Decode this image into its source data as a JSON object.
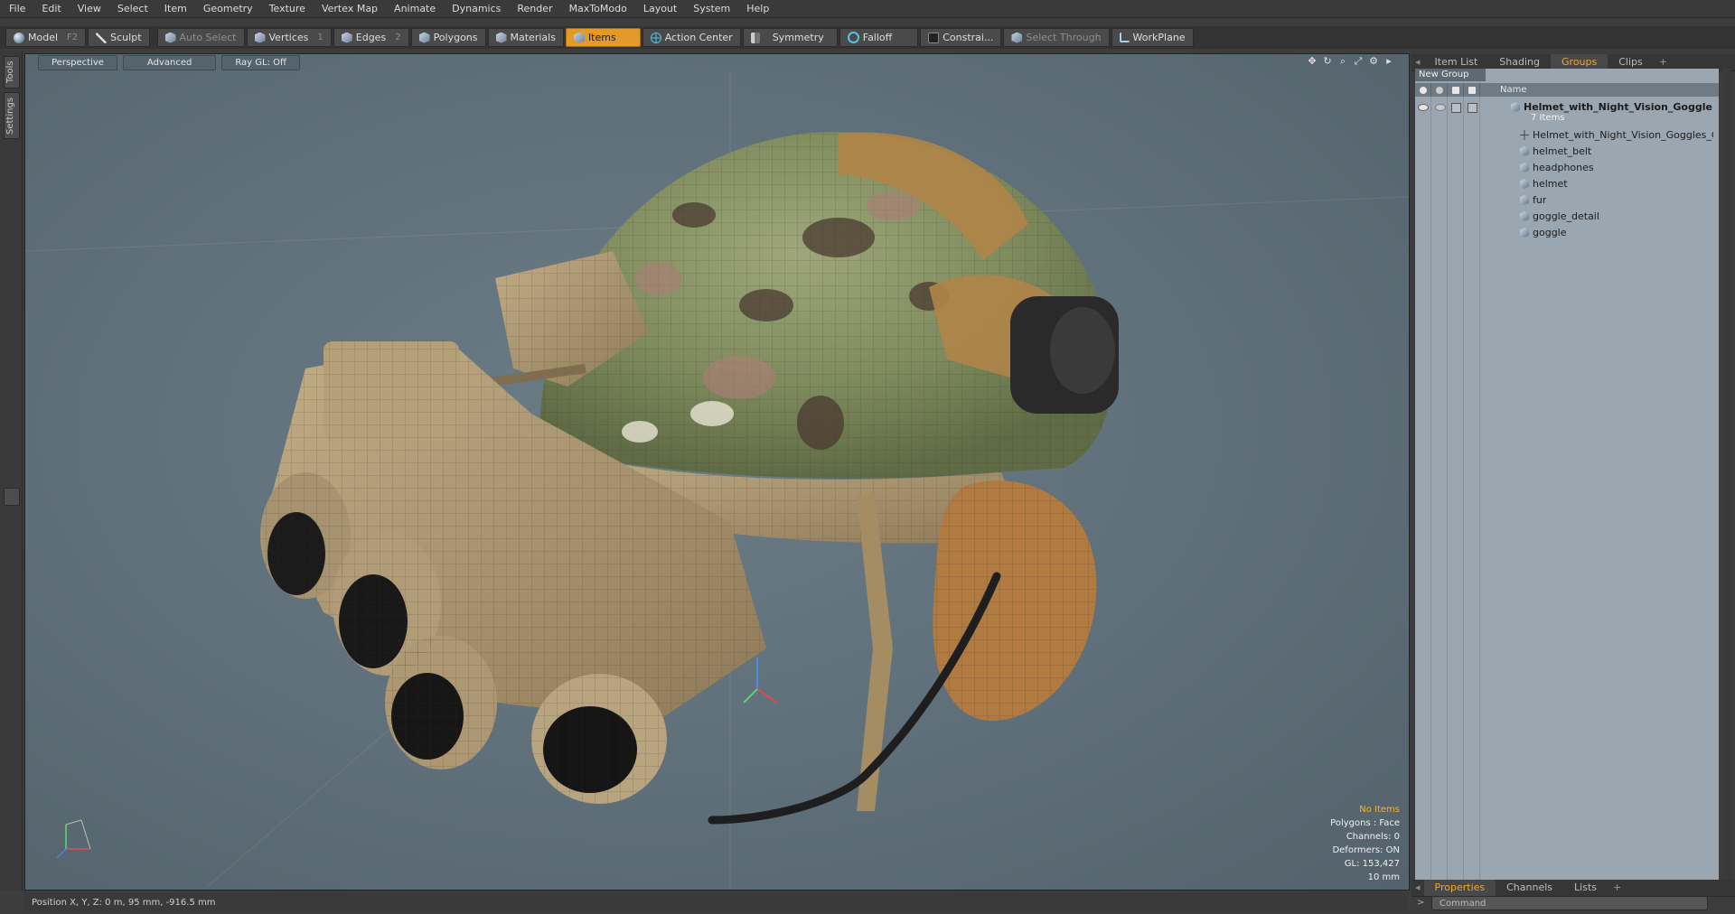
{
  "menu": [
    "File",
    "Edit",
    "View",
    "Select",
    "Item",
    "Geometry",
    "Texture",
    "Vertex Map",
    "Animate",
    "Dynamics",
    "Render",
    "MaxToModo",
    "Layout",
    "System",
    "Help"
  ],
  "toolbar": {
    "model": {
      "label": "Model",
      "key": "F2",
      "icon": "sphere-icon"
    },
    "sculpt": {
      "label": "Sculpt",
      "icon": "brush-icon"
    },
    "auto_select": {
      "label": "Auto Select",
      "icon": "cube-icon"
    },
    "vertices": {
      "label": "Vertices",
      "key": "1",
      "icon": "cube-icon"
    },
    "edges": {
      "label": "Edges",
      "key": "2",
      "icon": "cube-icon"
    },
    "polygons": {
      "label": "Polygons",
      "icon": "cube-icon"
    },
    "materials": {
      "label": "Materials",
      "icon": "cube-icon"
    },
    "items": {
      "label": "Items",
      "icon": "cube-icon",
      "active": true
    },
    "action_center": {
      "label": "Action Center",
      "icon": "crosshair-icon"
    },
    "symmetry": {
      "label": "Symmetry",
      "icon": "symmetry-icon"
    },
    "falloff": {
      "label": "Falloff",
      "icon": "ring-icon"
    },
    "constraints": {
      "label": "Constrai...",
      "icon": "box-icon"
    },
    "select_through": {
      "label": "Select Through",
      "icon": "cube-icon"
    },
    "workplane": {
      "label": "WorkPlane",
      "icon": "workplane-icon"
    }
  },
  "left_tabs": [
    "Tools",
    "Settings"
  ],
  "viewport": {
    "buttons": [
      "Perspective",
      "Advanced",
      "Ray GL: Off"
    ],
    "info": {
      "selection": "No Items",
      "polygons": "Polygons : Face",
      "channels": "Channels: 0",
      "deformers": "Deformers: ON",
      "gl": "GL: 153,427",
      "scale": "10 mm"
    },
    "accent_color": "#f0b23c"
  },
  "status": {
    "position": "Position X, Y, Z:   0 m, 95 mm, -916.5 mm"
  },
  "right_panel": {
    "top_tabs": [
      "Item List",
      "Shading",
      "Groups",
      "Clips",
      "+"
    ],
    "active_tab": "Groups",
    "new_group": "New Group",
    "column_name": "Name",
    "group": {
      "name": "Helmet_with_Night_Vision_Goggle...",
      "count": "7 Items"
    },
    "items": [
      {
        "name": "Helmet_with_Night_Vision_Goggles_Gr...",
        "icon": "locator-icon"
      },
      {
        "name": "helmet_belt",
        "icon": "mesh-icon"
      },
      {
        "name": "headphones",
        "icon": "mesh-icon"
      },
      {
        "name": "helmet",
        "icon": "mesh-icon"
      },
      {
        "name": "fur",
        "icon": "mesh-icon"
      },
      {
        "name": "goggle_detail",
        "icon": "mesh-icon"
      },
      {
        "name": "goggle",
        "icon": "mesh-icon"
      }
    ],
    "bottom_tabs": [
      "Properties",
      "Channels",
      "Lists",
      "+"
    ],
    "command_placeholder": "Command"
  }
}
